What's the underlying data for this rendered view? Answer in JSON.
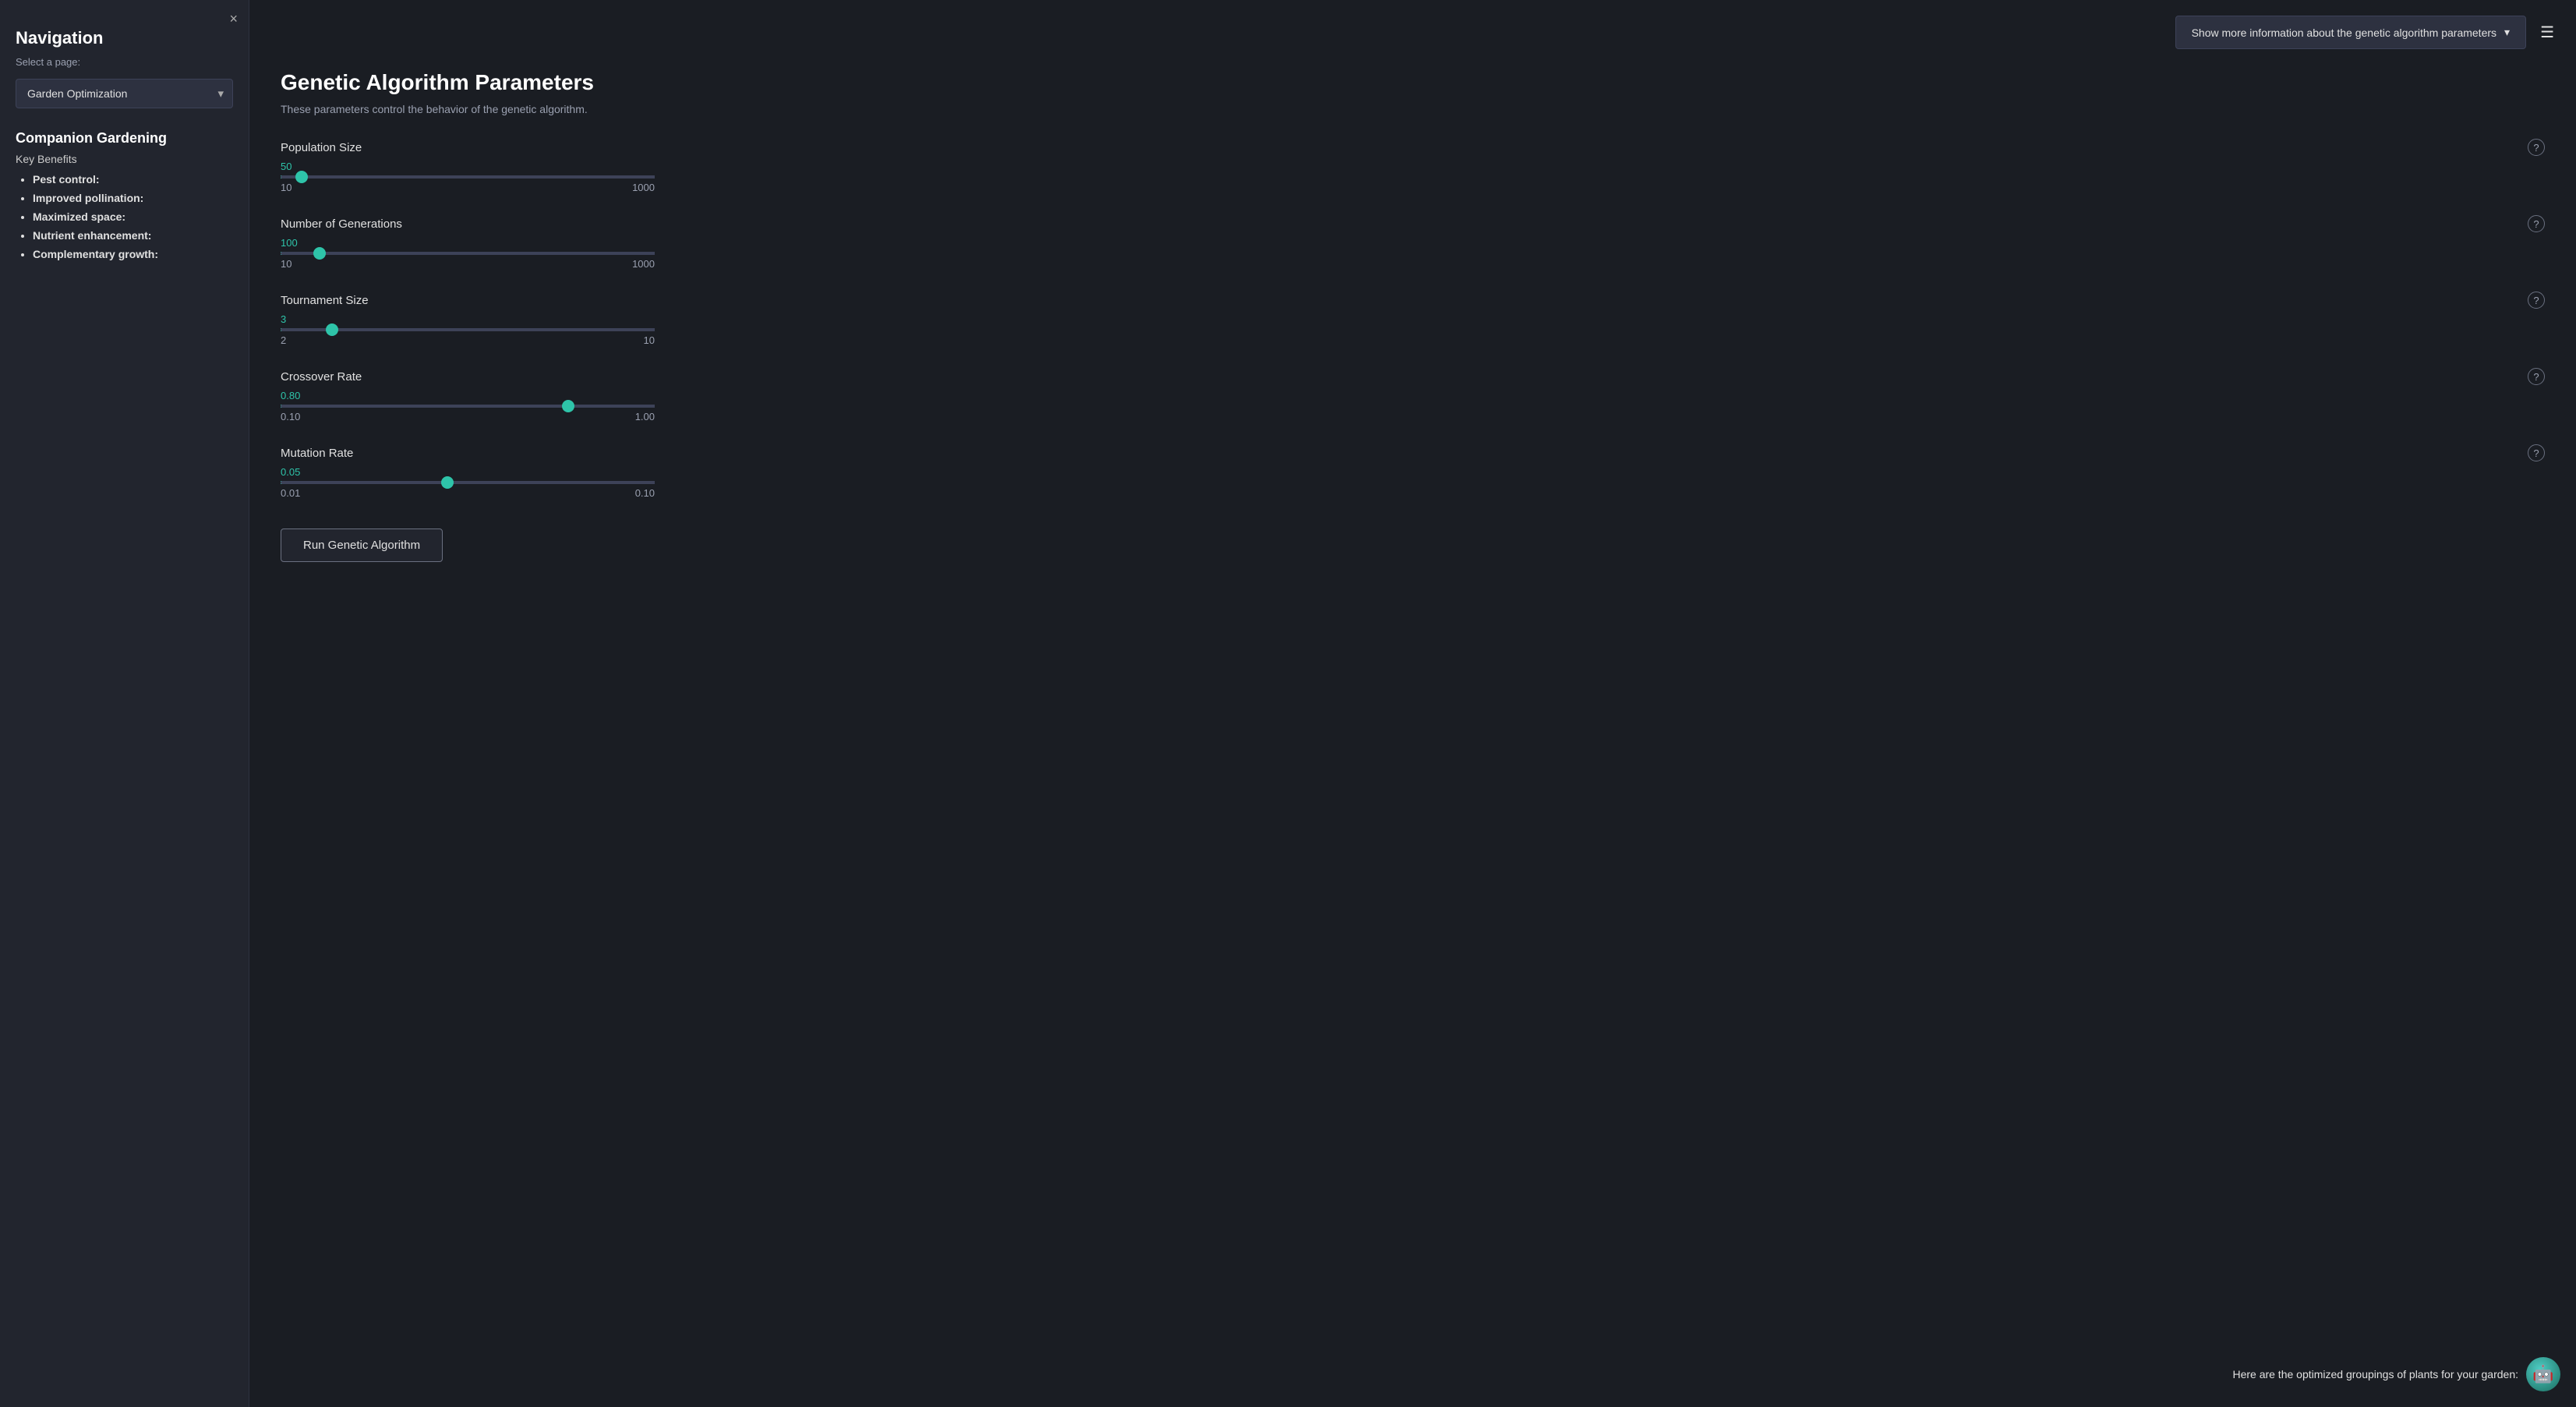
{
  "sidebar": {
    "close_icon": "×",
    "nav_title": "Navigation",
    "select_label": "Select a page:",
    "page_options": [
      "Garden Optimization"
    ],
    "page_selected": "Garden Optimization",
    "companion_title": "Companion Gardening",
    "key_benefits_label": "Key Benefits",
    "benefits": [
      "Pest control:",
      "Improved pollination:",
      "Maximized space:",
      "Nutrient enhancement:",
      "Complementary growth:"
    ]
  },
  "topbar": {
    "info_dropdown_label": "Show more information about the genetic algorithm parameters",
    "hamburger_icon": "☰"
  },
  "main": {
    "page_title": "Genetic Algorithm Parameters",
    "page_desc": "These parameters control the behavior of the genetic algorithm.",
    "params": [
      {
        "id": "population_size",
        "label": "Population Size",
        "value": 50,
        "min": 10,
        "max": 1000,
        "step": 1,
        "percent": 4.1
      },
      {
        "id": "num_generations",
        "label": "Number of Generations",
        "value": 100,
        "min": 10,
        "max": 1000,
        "step": 1,
        "percent": 9.3
      },
      {
        "id": "tournament_size",
        "label": "Tournament Size",
        "value": 3,
        "min": 2,
        "max": 10,
        "step": 1,
        "percent": 12.5
      },
      {
        "id": "crossover_rate",
        "label": "Crossover Rate",
        "value": 0.8,
        "min": 0.1,
        "max": 1.0,
        "step": 0.01,
        "percent": 77.8,
        "min_label": "0.10",
        "max_label": "1.00",
        "value_label": "0.80"
      },
      {
        "id": "mutation_rate",
        "label": "Mutation Rate",
        "value": 0.05,
        "min": 0.01,
        "max": 0.1,
        "step": 0.01,
        "percent": 44.4,
        "min_label": "0.01",
        "max_label": "0.10",
        "value_label": "0.05"
      }
    ],
    "run_button_label": "Run Genetic Algorithm",
    "bottom_text": "Here are the optimized groupings of plants for your garden:"
  }
}
